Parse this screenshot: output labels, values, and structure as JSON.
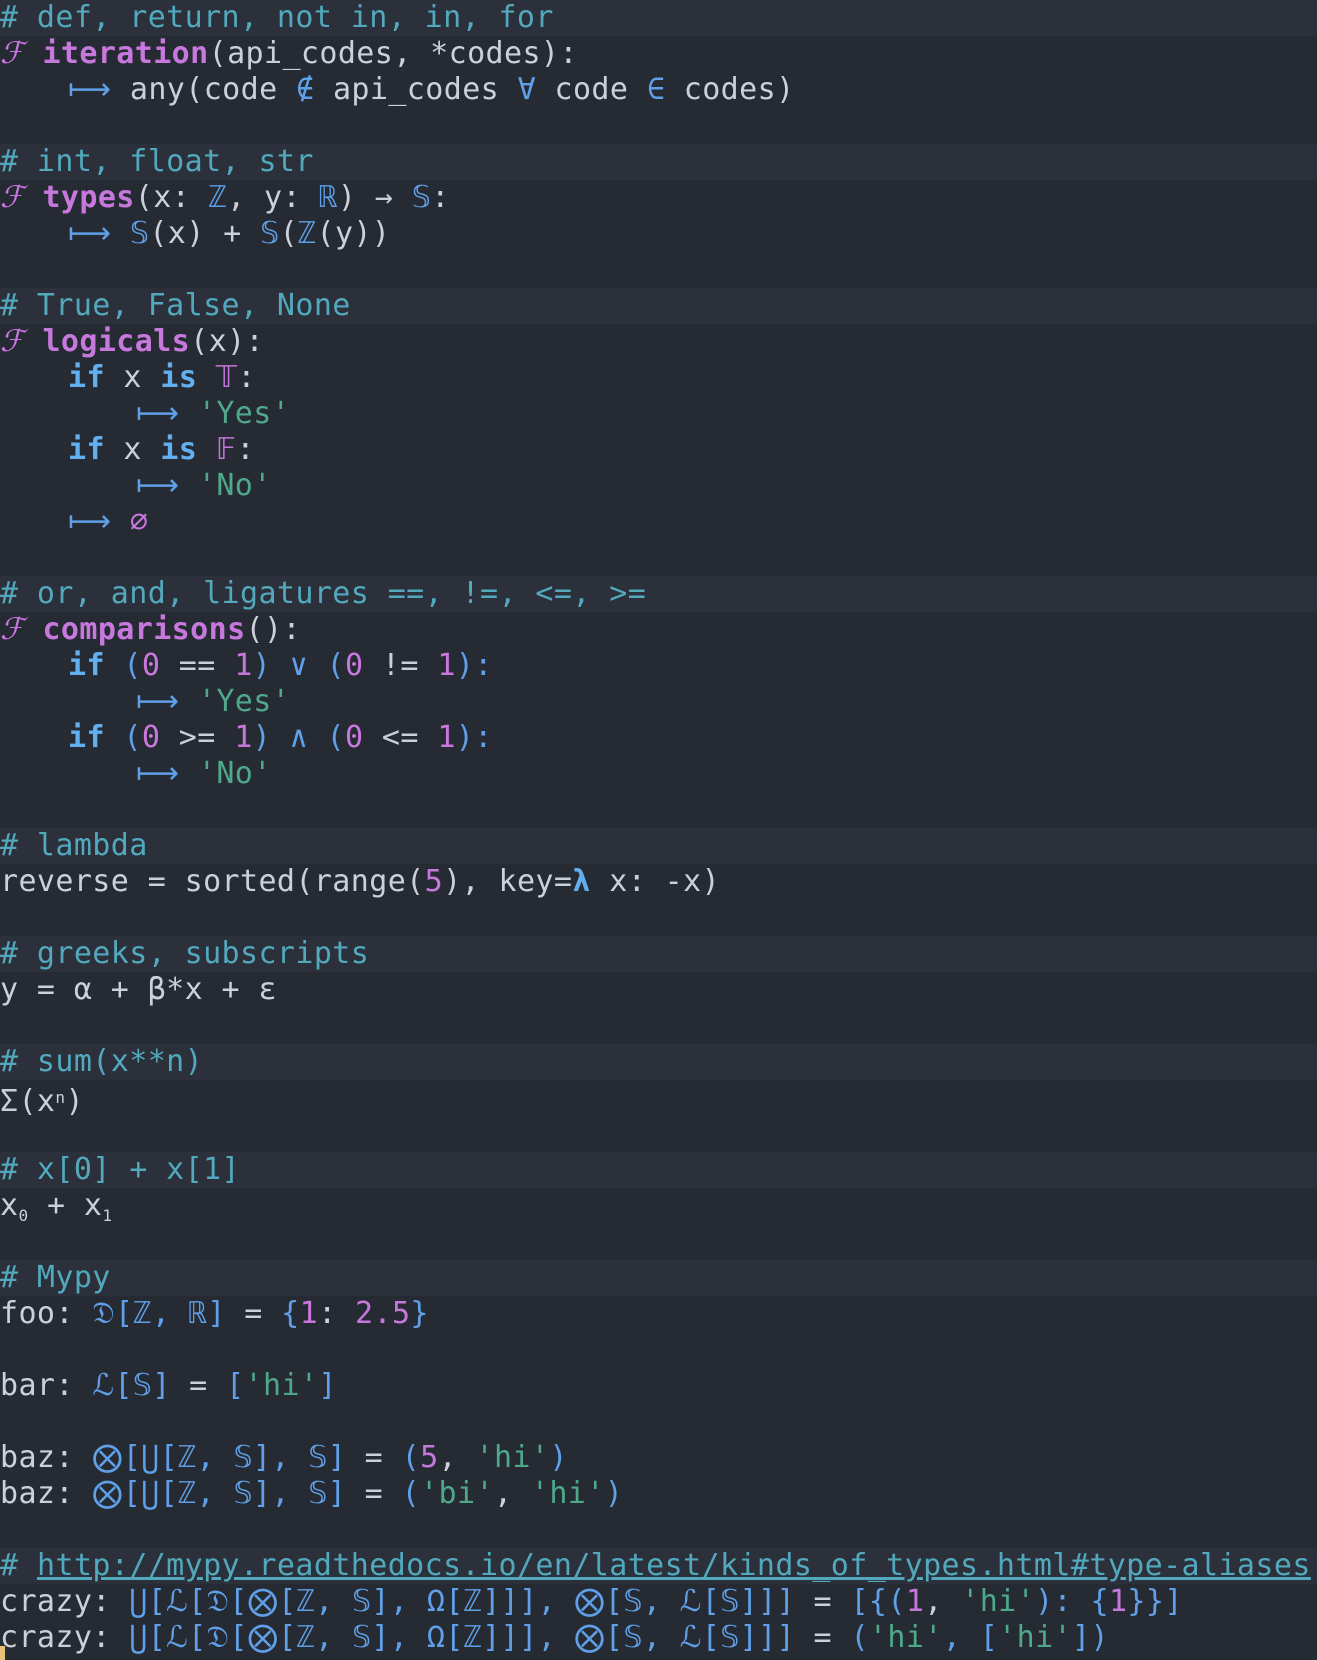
{
  "colors": {
    "background": "#262a33",
    "comment": "#52a9bd",
    "keyword": "#c678dd",
    "function": "#c678dd",
    "symbol": "#5fa0e8",
    "number": "#c678dd",
    "string": "#4ea98a",
    "text": "#cbd0d9"
  },
  "code": {
    "l1": "# def, return, not in, in, for",
    "l2_mark": "ℱ",
    "l2_fn": "iteration",
    "l2_rest": "(api_codes, *codes):",
    "l3_a": "⟼ ",
    "l3_b": "any(code ",
    "l3_c": "∉",
    "l3_d": " api_codes ",
    "l3_e": "∀",
    "l3_f": " code ",
    "l3_g": "∈",
    "l3_h": " codes)",
    "l5": "# int, float, str",
    "l6_mark": "ℱ",
    "l6_fn": "types",
    "l6_a": "(x: ",
    "l6_b": "ℤ",
    "l6_c": ", y: ",
    "l6_d": "ℝ",
    "l6_e": ") → ",
    "l6_f": "𝕊",
    "l6_g": ":",
    "l7_a": "⟼ ",
    "l7_b": "𝕊",
    "l7_c": "(x) + ",
    "l7_d": "𝕊",
    "l7_e": "(",
    "l7_f": "ℤ",
    "l7_g": "(y))",
    "l9": "# True, False, None",
    "l10_mark": "ℱ",
    "l10_fn": "logicals",
    "l10_rest": "(x):",
    "l11_if": "if",
    "l11_a": " x ",
    "l11_is": "is",
    "l11_b": " ",
    "l11_c": "𝕋",
    "l11_d": ":",
    "l12_a": "⟼ ",
    "l12_b": "'Yes'",
    "l13_if": "if",
    "l13_a": " x ",
    "l13_is": "is",
    "l13_b": " ",
    "l13_c": "𝔽",
    "l13_d": ":",
    "l14_a": "⟼ ",
    "l14_b": "'No'",
    "l15_a": "⟼ ",
    "l15_b": "∅",
    "l17": "# or, and, ligatures ==, !=, <=, >=",
    "l18_mark": "ℱ",
    "l18_fn": "comparisons",
    "l18_rest": "():",
    "l19_if": "if",
    "l19_a": " (",
    "l19_b": "0",
    "l19_c": " == ",
    "l19_d": "1",
    "l19_e": ") ∨ (",
    "l19_f": "0",
    "l19_g": " != ",
    "l19_h": "1",
    "l19_i": "):",
    "l20_a": "⟼ ",
    "l20_b": "'Yes'",
    "l21_if": "if",
    "l21_a": " (",
    "l21_b": "0",
    "l21_c": " >= ",
    "l21_d": "1",
    "l21_e": ") ∧ (",
    "l21_f": "0",
    "l21_g": " <= ",
    "l21_h": "1",
    "l21_i": "):",
    "l22_a": "⟼ ",
    "l22_b": "'No'",
    "l24": "# lambda",
    "l25_a": "reverse = sorted(range(",
    "l25_b": "5",
    "l25_c": "), key=",
    "l25_d": "λ",
    "l25_e": " x: -x)",
    "l27": "# greeks, subscripts",
    "l28": "y = α + β*x + ε",
    "l30": "# sum(x**n)",
    "l31_a": "Σ(x",
    "l31_b": "n",
    "l31_c": ")",
    "l33": "# x[0] + x[1]",
    "l34_a": "x",
    "l34_b": "0",
    "l34_c": " + x",
    "l34_d": "1",
    "l36": "# Mypy",
    "l37_a": "foo: ",
    "l37_b": "𝔇[ℤ, ℝ]",
    "l37_c": " = ",
    "l37_d": "{",
    "l37_e": "1",
    "l37_f": ": ",
    "l37_g": "2.5",
    "l37_h": "}",
    "l39_a": "bar: ",
    "l39_b": "ℒ[𝕊]",
    "l39_c": " = ",
    "l39_d": "[",
    "l39_e": "'hi'",
    "l39_f": "]",
    "l41_a": "baz: ",
    "l41_b": "⨂[⋃[ℤ, 𝕊], 𝕊]",
    "l41_c": " = ",
    "l41_d": "(",
    "l41_e": "5",
    "l41_f": ", ",
    "l41_g": "'hi'",
    "l41_h": ")",
    "l42_a": "baz: ",
    "l42_b": "⨂[⋃[ℤ, 𝕊], 𝕊]",
    "l42_c": " = ",
    "l42_d": "(",
    "l42_e": "'bi'",
    "l42_f": ", ",
    "l42_g": "'hi'",
    "l42_h": ")",
    "l44_a": "# ",
    "l44_b": "http://mypy.readthedocs.io/en/latest/kinds_of_types.html#type-aliases",
    "l45_a": "crazy: ",
    "l45_b": "⋃[ℒ[𝔇[⨂[ℤ, 𝕊], Ω[ℤ]]], ⨂[𝕊, ℒ[𝕊]]]",
    "l45_c": " = ",
    "l45_d": "[{(",
    "l45_e": "1",
    "l45_f": ", ",
    "l45_g": "'hi'",
    "l45_h": "): {",
    "l45_i": "1",
    "l45_j": "}}]",
    "l46_a": "crazy: ",
    "l46_b": "⋃[ℒ[𝔇[⨂[ℤ, 𝕊], Ω[ℤ]]], ⨂[𝕊, ℒ[𝕊]]]",
    "l46_c": " = ",
    "l46_d": "(",
    "l46_e": "'hi'",
    "l46_f": ", [",
    "l46_g": "'hi'",
    "l46_h": "])"
  }
}
